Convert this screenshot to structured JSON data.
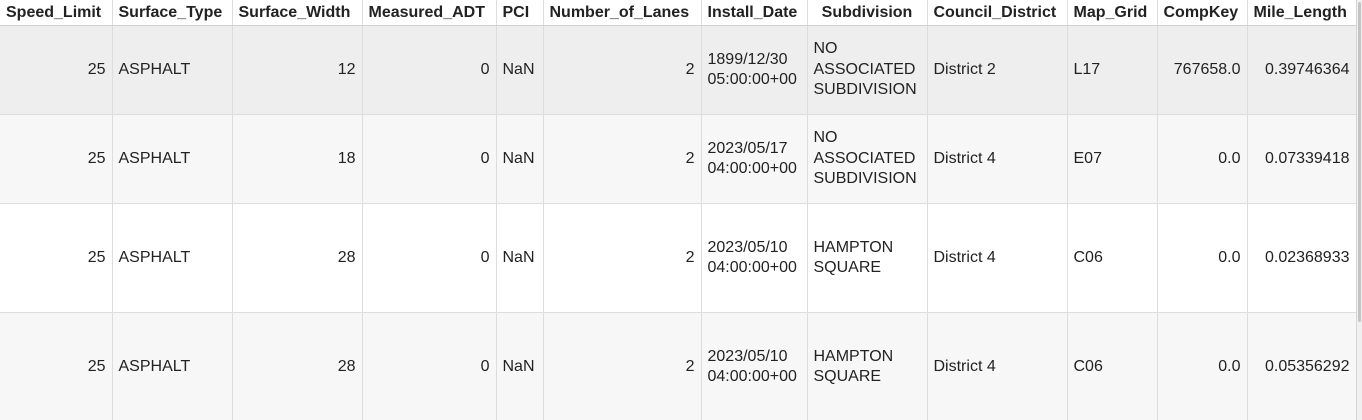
{
  "table": {
    "columns": [
      "Speed_Limit",
      "Surface_Type",
      "Surface_Width",
      "Measured_ADT",
      "PCI",
      "Number_of_Lanes",
      "Install_Date",
      "Subdivision",
      "Council_District",
      "Map_Grid",
      "CompKey",
      "Mile_Length"
    ],
    "rows": [
      [
        "25",
        "ASPHALT",
        "12",
        "0",
        "NaN",
        "2",
        "1899/12/30 05:00:00+00",
        "NO ASSOCIATED SUBDIVISION",
        "District 2",
        "L17",
        "767658.0",
        "0.39746364"
      ],
      [
        "25",
        "ASPHALT",
        "18",
        "0",
        "NaN",
        "2",
        "2023/05/17 04:00:00+00",
        "NO ASSOCIATED SUBDIVISION",
        "District 4",
        "E07",
        "0.0",
        "0.07339418"
      ],
      [
        "25",
        "ASPHALT",
        "28",
        "0",
        "NaN",
        "2",
        "2023/05/10 04:00:00+00",
        "HAMPTON SQUARE",
        "District 4",
        "C06",
        "0.0",
        "0.02368933"
      ],
      [
        "25",
        "ASPHALT",
        "28",
        "0",
        "NaN",
        "2",
        "2023/05/10 04:00:00+00",
        "HAMPTON SQUARE",
        "District 4",
        "C06",
        "0.0",
        "0.05356292"
      ]
    ]
  }
}
